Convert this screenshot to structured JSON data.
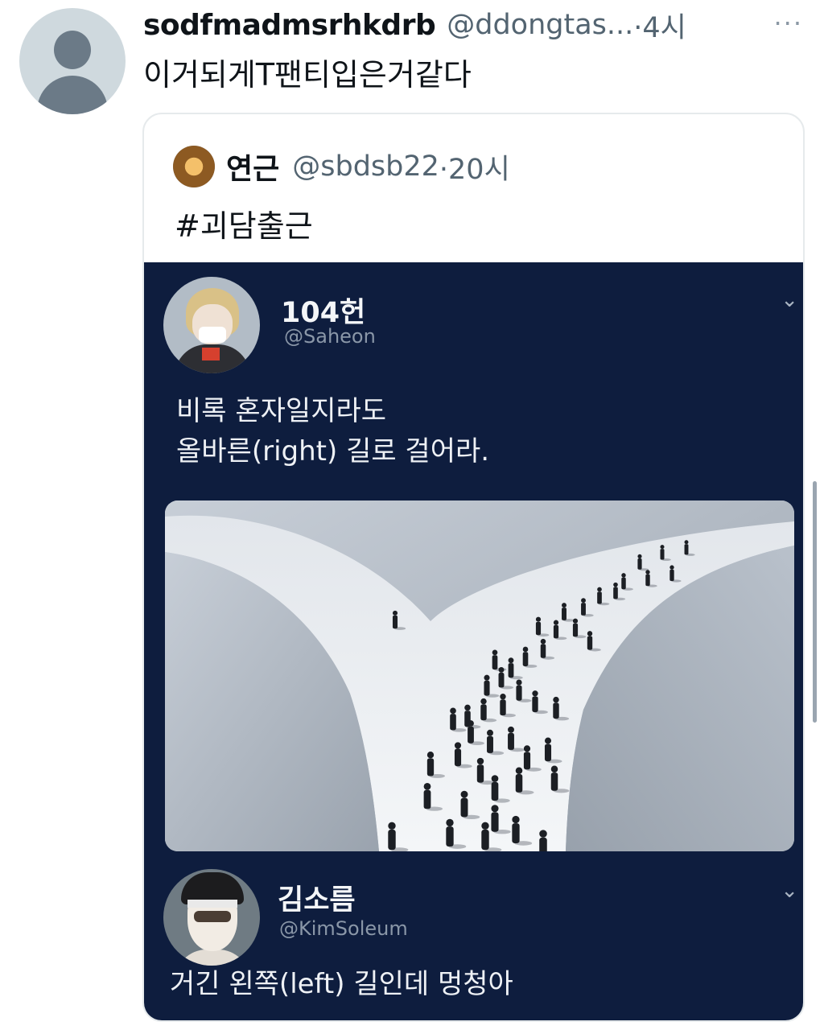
{
  "tweet": {
    "display_name": "sodfmadmsrhkdrb",
    "handle": "@ddongtas...",
    "time": "·4시",
    "more_label": "···",
    "text": "이거되게T팬티입은거같다"
  },
  "quoted": {
    "display_name": "연근",
    "handle": "@sbdsb22",
    "time": "·20시",
    "text": "#괴담출근",
    "media": {
      "post1": {
        "name": "104헌",
        "handle": "@Saheon",
        "chevron": "⌄",
        "line1": "비록 혼자일지라도",
        "line2": "올바른(right) 길로 걸어라."
      },
      "post2": {
        "name": "김소름",
        "handle": "@KimSoleum",
        "chevron": "⌄",
        "text": "거긴 왼쪽(left) 길인데 멍청아"
      }
    }
  },
  "colors": {
    "media_background": "#0e1d3e",
    "handle_gray": "#536471",
    "border": "#e6eaec"
  },
  "icons": {
    "more": "more-icon",
    "chevron": "chevron-down-icon"
  }
}
